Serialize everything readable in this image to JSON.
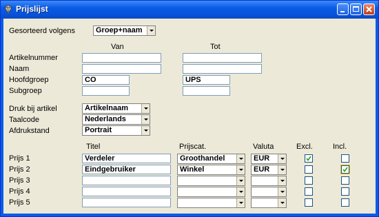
{
  "window": {
    "title": "Prijslijst"
  },
  "sort": {
    "label": "Gesorteerd volgens",
    "value": "Groep+naam"
  },
  "range": {
    "col_from": "Van",
    "col_to": "Tot",
    "rows": [
      {
        "label": "Artikelnummer",
        "from": "",
        "to": ""
      },
      {
        "label": "Naam",
        "from": "",
        "to": ""
      },
      {
        "label": "Hoofdgroep",
        "from": "CO",
        "to": "UPS"
      },
      {
        "label": "Subgroep",
        "from": "",
        "to": ""
      }
    ]
  },
  "options": [
    {
      "label": "Druk bij artikel",
      "value": "Artikelnaam"
    },
    {
      "label": "Taalcode",
      "value": "Nederlands"
    },
    {
      "label": "Afdrukstand",
      "value": "Portrait"
    }
  ],
  "prices": {
    "headers": {
      "title": "Titel",
      "pricecat": "Prijscat.",
      "currency": "Valuta",
      "excl": "Excl.",
      "incl": "Incl."
    },
    "rows": [
      {
        "label": "Prijs 1",
        "title": "Verdeler",
        "pricecat": "Groothandel",
        "currency": "EUR",
        "excl": true,
        "incl": false
      },
      {
        "label": "Prijs 2",
        "title": "Eindgebruiker",
        "pricecat": "Winkel",
        "currency": "EUR",
        "excl": false,
        "incl": true
      },
      {
        "label": "Prijs 3",
        "title": "",
        "pricecat": "",
        "currency": "",
        "excl": false,
        "incl": false
      },
      {
        "label": "Prijs 4",
        "title": "",
        "pricecat": "",
        "currency": "",
        "excl": false,
        "incl": false
      },
      {
        "label": "Prijs 5",
        "title": "",
        "pricecat": "",
        "currency": "",
        "excl": false,
        "incl": false
      }
    ]
  }
}
